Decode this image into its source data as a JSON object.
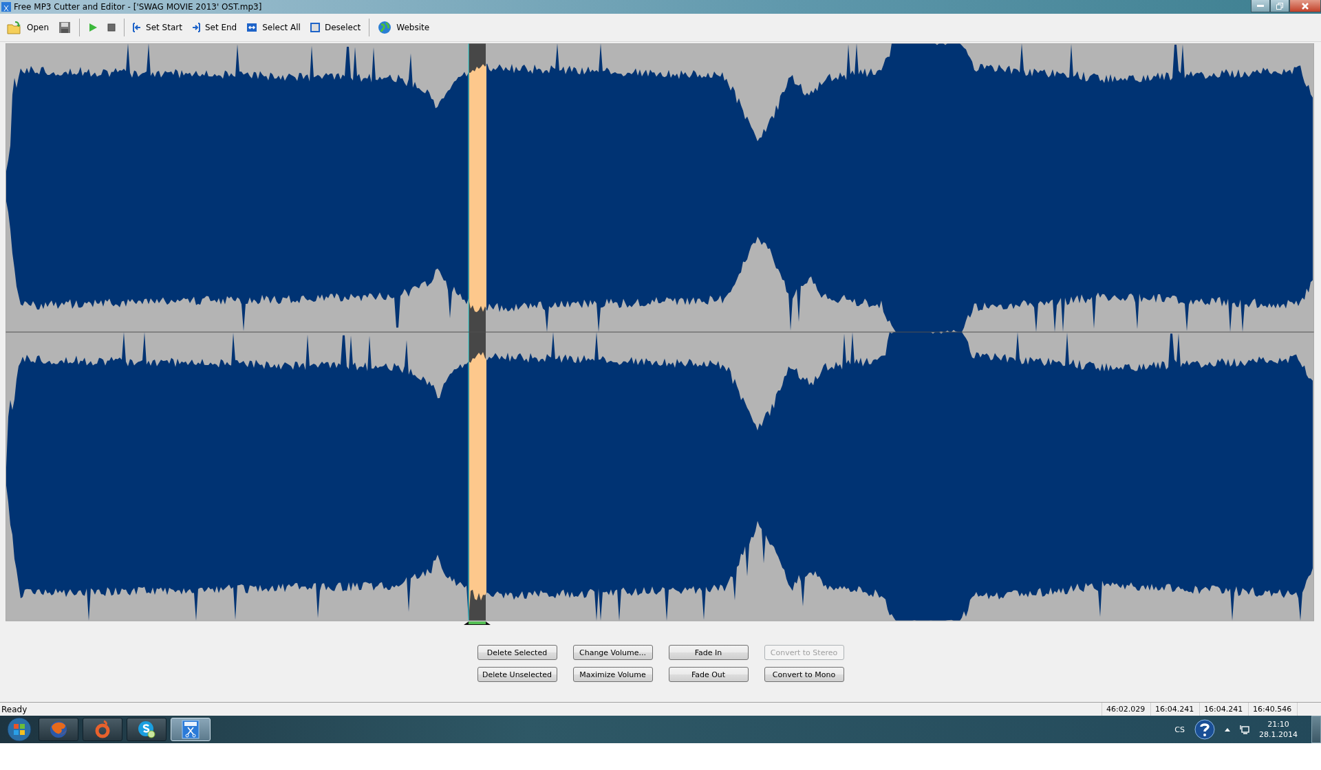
{
  "window": {
    "title": "Free MP3 Cutter and Editor - ['SWAG MOVIE 2013' OST.mp3]"
  },
  "toolbar": [
    {
      "kind": "open",
      "label": "Open"
    },
    {
      "kind": "save"
    },
    {
      "kind": "separator"
    },
    {
      "kind": "play"
    },
    {
      "kind": "stop"
    },
    {
      "kind": "separator"
    },
    {
      "kind": "set-start",
      "label": "Set Start"
    },
    {
      "kind": "set-end",
      "label": "Set End"
    },
    {
      "kind": "select-all",
      "label": "Select All"
    },
    {
      "kind": "deselect",
      "label": "Deselect"
    },
    {
      "kind": "separator"
    },
    {
      "kind": "website",
      "label": "Website"
    }
  ],
  "actions": [
    {
      "label": "Delete Selected",
      "disabled": false
    },
    {
      "label": "Change Volume...",
      "disabled": false
    },
    {
      "label": "Fade In",
      "disabled": false
    },
    {
      "label": "Convert to Stereo",
      "disabled": true
    },
    {
      "label": "Delete Unselected",
      "disabled": false
    },
    {
      "label": "Maximize Volume",
      "disabled": false
    },
    {
      "label": "Fade Out",
      "disabled": false
    },
    {
      "label": "Convert to Mono",
      "disabled": false
    }
  ],
  "status_bar": {
    "message": "Ready",
    "fields": [
      "46:02.029",
      "16:04.241",
      "16:04.241",
      "16:40.546"
    ]
  },
  "taskbar": {
    "apps": [
      {
        "kind": "firefox",
        "selected": false
      },
      {
        "kind": "origin",
        "selected": false
      },
      {
        "kind": "skype",
        "selected": false
      },
      {
        "kind": "mp3",
        "selected": true
      }
    ],
    "language": "CS",
    "time": "21:10",
    "date": "28.1.2014"
  }
}
